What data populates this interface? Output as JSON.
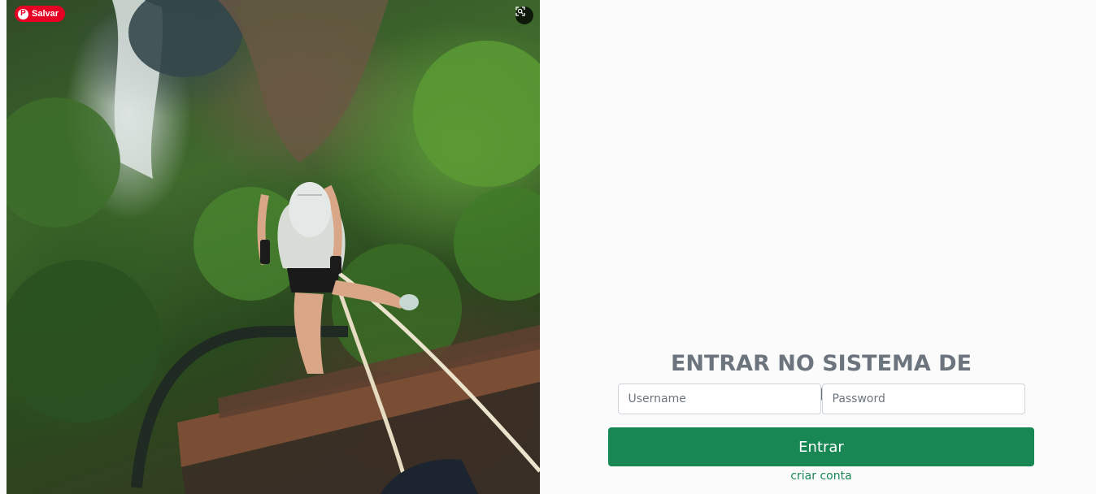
{
  "photo": {
    "alt_subject": "rappel-photo",
    "pinterest_save_label": "Salvar",
    "pinterest_color": "#e60023"
  },
  "login": {
    "title": "ENTRAR NO SISTEMA DE RECADOS",
    "username_placeholder": "Username",
    "password_placeholder": "Password",
    "submit_label": "Entrar",
    "create_account_label": "criar conta",
    "accent_color": "#198754",
    "title_color": "#6c757d"
  }
}
